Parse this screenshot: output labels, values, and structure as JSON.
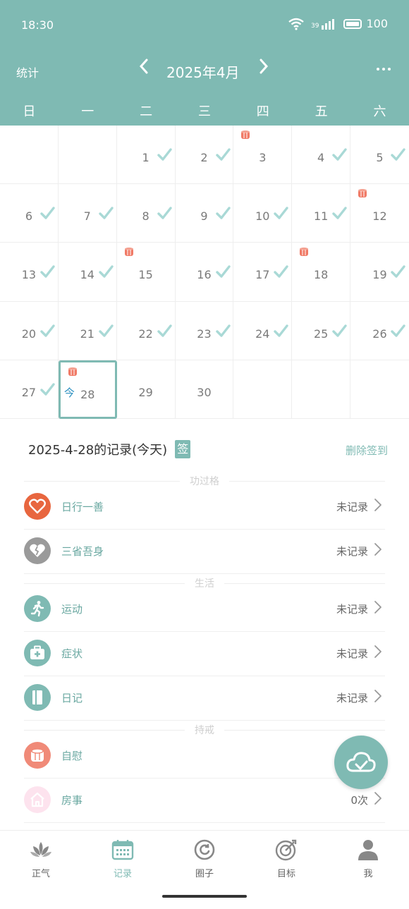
{
  "status_bar": {
    "time": "18:30",
    "signal_label": "39",
    "battery": "100"
  },
  "header": {
    "stats_label": "统计",
    "prev": "‹",
    "month": "2025年4月",
    "next": "›",
    "more": "···"
  },
  "weekdays": [
    "日",
    "一",
    "二",
    "三",
    "四",
    "五",
    "六"
  ],
  "calendar": {
    "weeks": [
      [
        {
          "d": ""
        },
        {
          "d": ""
        },
        {
          "d": "1",
          "check": true
        },
        {
          "d": "2",
          "check": true
        },
        {
          "d": "3",
          "tissue": true
        },
        {
          "d": "4",
          "check": true
        },
        {
          "d": "5",
          "check": true
        }
      ],
      [
        {
          "d": "6",
          "check": true
        },
        {
          "d": "7",
          "check": true
        },
        {
          "d": "8",
          "check": true
        },
        {
          "d": "9",
          "check": true
        },
        {
          "d": "10",
          "check": true
        },
        {
          "d": "11",
          "check": true
        },
        {
          "d": "12",
          "tissue": true
        }
      ],
      [
        {
          "d": "13",
          "check": true
        },
        {
          "d": "14",
          "check": true
        },
        {
          "d": "15",
          "tissue": true
        },
        {
          "d": "16",
          "check": true
        },
        {
          "d": "17",
          "check": true
        },
        {
          "d": "18",
          "tissue": true
        },
        {
          "d": "19",
          "check": true
        }
      ],
      [
        {
          "d": "20",
          "check": true
        },
        {
          "d": "21",
          "check": true
        },
        {
          "d": "22",
          "check": true
        },
        {
          "d": "23",
          "check": true
        },
        {
          "d": "24",
          "check": true
        },
        {
          "d": "25",
          "check": true
        },
        {
          "d": "26",
          "check": true
        }
      ],
      [
        {
          "d": "27",
          "check": true
        },
        {
          "d": "28",
          "tissue": true,
          "today": true
        },
        {
          "d": "29"
        },
        {
          "d": "30"
        },
        {
          "d": ""
        },
        {
          "d": ""
        },
        {
          "d": ""
        }
      ]
    ],
    "today_label": "今"
  },
  "records": {
    "date_title": "2025-4-28的记录(今天)",
    "sign_badge": "签",
    "delete_sign": "删除签到",
    "sections": [
      {
        "title": "功过格",
        "items": [
          {
            "name": "heart",
            "label": "日行一善",
            "status": "未记录",
            "color": "#e8663f"
          },
          {
            "name": "broken-heart",
            "label": "三省吾身",
            "status": "未记录",
            "color": "#9a9a9a"
          }
        ]
      },
      {
        "title": "生活",
        "items": [
          {
            "name": "run",
            "label": "运动",
            "status": "未记录",
            "color": "#7fbab3"
          },
          {
            "name": "medkit",
            "label": "症状",
            "status": "未记录",
            "color": "#7fbab3"
          },
          {
            "name": "diary",
            "label": "日记",
            "status": "未记录",
            "color": "#7fbab3"
          }
        ]
      },
      {
        "title": "持戒",
        "items": [
          {
            "name": "tissue",
            "label": "自慰",
            "status": "",
            "color": "#f08a78"
          },
          {
            "name": "house",
            "label": "房事",
            "status": "0次",
            "color": "#fde3ee"
          }
        ]
      }
    ]
  },
  "bottom_nav": [
    {
      "name": "lotus",
      "label": "正气"
    },
    {
      "name": "calendar",
      "label": "记录",
      "active": true
    },
    {
      "name": "circle",
      "label": "圈子"
    },
    {
      "name": "target",
      "label": "目标"
    },
    {
      "name": "user",
      "label": "我"
    }
  ]
}
